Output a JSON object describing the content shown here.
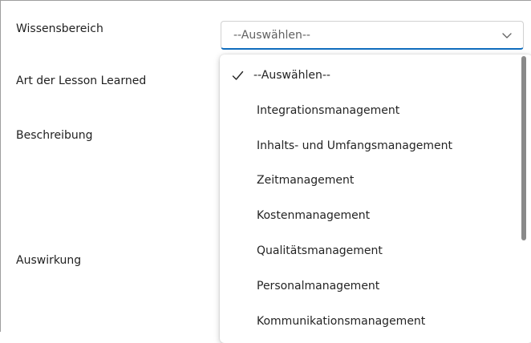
{
  "form": {
    "labels": {
      "wissensbereich": "Wissensbereich",
      "art": "Art der Lesson Learned",
      "beschreibung": "Beschreibung",
      "auswirkung": "Auswirkung"
    }
  },
  "select": {
    "value": "--Auswählen--",
    "icon": "chevron-down-icon"
  },
  "dropdown": {
    "options": [
      {
        "label": "--Auswählen--",
        "selected": true
      },
      {
        "label": "Integrationsmanagement",
        "selected": false
      },
      {
        "label": "Inhalts- und Umfangsmanagement",
        "selected": false
      },
      {
        "label": "Zeitmanagement",
        "selected": false
      },
      {
        "label": "Kostenmanagement",
        "selected": false
      },
      {
        "label": "Qualitätsmanagement",
        "selected": false
      },
      {
        "label": "Personalmanagement",
        "selected": false
      },
      {
        "label": "Kommunikationsmanagement",
        "selected": false
      }
    ]
  },
  "colors": {
    "accent": "#0f6cbd",
    "text": "#1f1f1f",
    "placeholder": "#616161",
    "scrollbar": "#8a8a8a"
  }
}
